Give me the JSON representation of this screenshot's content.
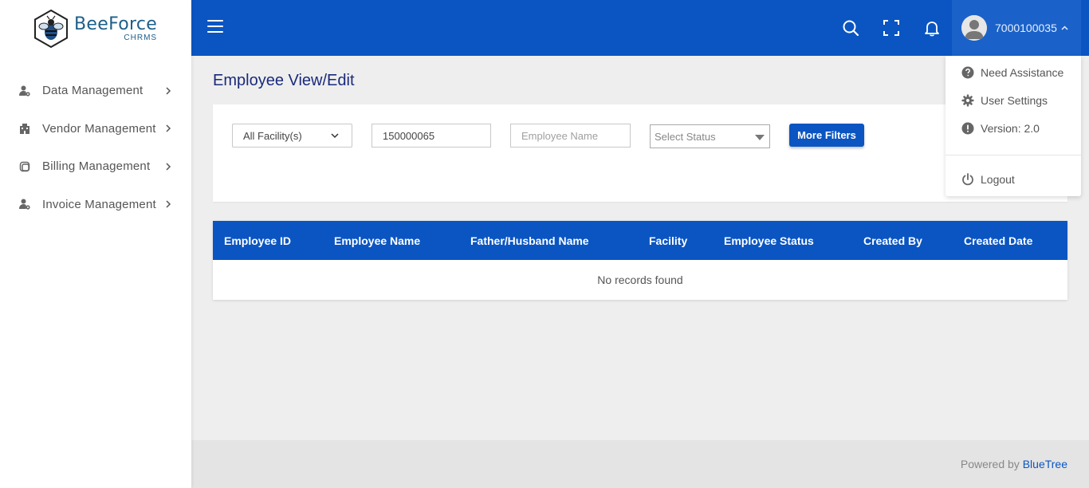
{
  "brand": {
    "name": "BeeForce",
    "sub": "CHRMS"
  },
  "sidebar": {
    "items": [
      {
        "label": "Data Management",
        "icon": "user-gear-icon"
      },
      {
        "label": "Vendor Management",
        "icon": "building-icon"
      },
      {
        "label": "Billing Management",
        "icon": "billing-icon"
      },
      {
        "label": "Invoice Management",
        "icon": "user-gear-icon"
      }
    ]
  },
  "topbar": {
    "icons": [
      "menu-icon",
      "search-icon",
      "fullscreen-icon",
      "bell-icon"
    ],
    "user": "7000100035"
  },
  "user_menu": {
    "items": [
      {
        "label": "Need Assistance",
        "icon": "help-circle-icon"
      },
      {
        "label": "User Settings",
        "icon": "gear-icon"
      },
      {
        "label": "Version: 2.0",
        "icon": "alert-circle-icon"
      }
    ],
    "logout": "Logout"
  },
  "page": {
    "title": "Employee View/Edit"
  },
  "filters": {
    "facility": "All Facility(s)",
    "employee_id": "150000065",
    "employee_name_placeholder": "Employee Name",
    "status_placeholder": "Select Status",
    "more_filters": "More Filters"
  },
  "table": {
    "columns": [
      "Employee ID",
      "Employee Name",
      "Father/Husband Name",
      "Facility",
      "Employee Status",
      "Created By",
      "Created Date"
    ],
    "empty": "No records found"
  },
  "footer": {
    "prefix": "Powered by",
    "link": "BlueTree"
  },
  "colors": {
    "primary": "#0a55c2",
    "title": "#1a2a7a",
    "background": "#eeeeee"
  }
}
